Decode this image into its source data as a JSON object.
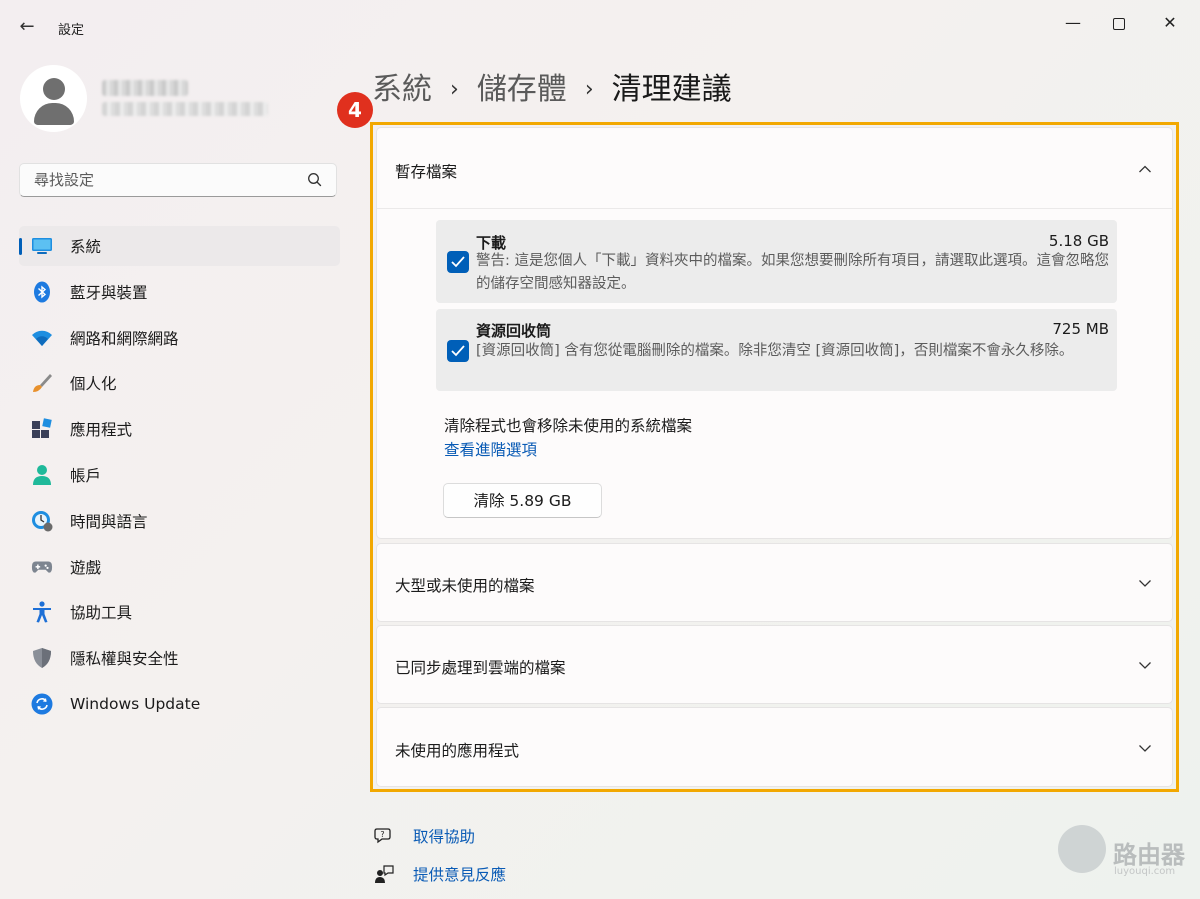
{
  "window": {
    "title": "設定",
    "back_icon": "back-arrow-icon"
  },
  "profile": {
    "name_redacted": true
  },
  "search": {
    "placeholder": "尋找設定"
  },
  "nav": {
    "items": [
      {
        "label": "系統",
        "icon": "system-icon",
        "active": true
      },
      {
        "label": "藍牙與裝置",
        "icon": "bluetooth-icon"
      },
      {
        "label": "網路和網際網路",
        "icon": "wifi-icon"
      },
      {
        "label": "個人化",
        "icon": "brush-icon"
      },
      {
        "label": "應用程式",
        "icon": "apps-icon"
      },
      {
        "label": "帳戶",
        "icon": "account-icon"
      },
      {
        "label": "時間與語言",
        "icon": "time-language-icon"
      },
      {
        "label": "遊戲",
        "icon": "gamepad-icon"
      },
      {
        "label": "協助工具",
        "icon": "accessibility-icon"
      },
      {
        "label": "隱私權與安全性",
        "icon": "shield-icon"
      },
      {
        "label": "Windows Update",
        "icon": "windows-update-icon"
      }
    ]
  },
  "breadcrumb": {
    "level1": "系統",
    "level2": "儲存體",
    "current": "清理建議",
    "separator": "›"
  },
  "step_badge": "4",
  "temp_files": {
    "title": "暫存檔案",
    "expanded": true,
    "items": [
      {
        "title": "下載",
        "size": "5.18 GB",
        "description": "警告: 這是您個人「下載」資料夾中的檔案。如果您想要刪除所有項目，請選取此選項。這會忽略您的儲存空間感知器設定。",
        "checked": true
      },
      {
        "title": "資源回收筒",
        "size": "725 MB",
        "description": "[資源回收筒] 含有您從電腦刪除的檔案。除非您清空 [資源回收筒]，否則檔案不會永久移除。",
        "checked": true
      }
    ],
    "note": "清除程式也會移除未使用的系統檔案",
    "advanced_link": "查看進階選項",
    "clean_button": "清除 5.89 GB"
  },
  "sections": [
    {
      "title": "大型或未使用的檔案"
    },
    {
      "title": "已同步處理到雲端的檔案"
    },
    {
      "title": "未使用的應用程式"
    }
  ],
  "footer": {
    "help": "取得協助",
    "feedback": "提供意見反應"
  },
  "watermark": {
    "text": "路由器",
    "sub": "luyouqi.com"
  },
  "colors": {
    "accent": "#005fb8",
    "highlight": "#f2a800",
    "badge": "#e0301e",
    "link": "#0a5bb5"
  }
}
